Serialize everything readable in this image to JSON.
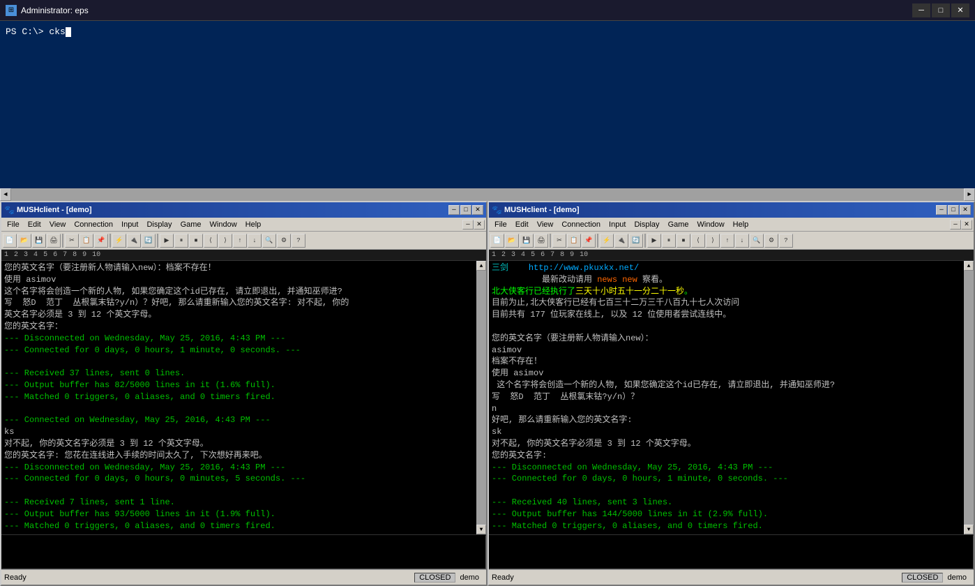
{
  "titlebar": {
    "icon": "⊞",
    "title": "Administrator: eps",
    "minimize": "─",
    "maximize": "□",
    "close": "✕"
  },
  "powershell": {
    "prompt": "PS C:\\> cks"
  },
  "scrollbar": {
    "left_arrow": "◄",
    "right_arrow": "►"
  },
  "panel_left": {
    "title": "MUSHclient - [demo]",
    "menus": [
      "File",
      "Edit",
      "View",
      "Connection",
      "Input",
      "Display",
      "Game",
      "Window",
      "Help"
    ],
    "statusbar": {
      "ready": "Ready",
      "closed": "CLOSED",
      "world": "demo"
    },
    "content": [
      {
        "color": "white",
        "text": "您的英文名字（要注册新人物请输入new）：档案不存在！"
      },
      {
        "color": "white",
        "text": "使用 asimov"
      },
      {
        "color": "white",
        "text": "这个名字将会创造一个新的人物, 如果您确定这个id已存在, 请立即退出, 并通知巫师进?"
      },
      {
        "color": "white",
        "text": "写  怒D  范丁  丛根氯末钴?y/n）？好吧, 那么请重新输入您的英文名字: 对不起, 你的"
      },
      {
        "color": "white",
        "text": "英文名字必须是 3 到 12 个英文字母。"
      },
      {
        "color": "white",
        "text": "您的英文名字："
      },
      {
        "color": "green",
        "text": "--- Disconnected on Wednesday, May 25, 2016, 4:43 PM ---"
      },
      {
        "color": "green",
        "text": "--- Connected for 0 days, 0 hours, 1 minute, 0 seconds. ---"
      },
      {
        "color": "white",
        "text": ""
      },
      {
        "color": "green",
        "text": "--- Received 37 lines, sent 0 lines."
      },
      {
        "color": "green",
        "text": "--- Output buffer has 82/5000 lines in it (1.6% full)."
      },
      {
        "color": "green",
        "text": "--- Matched 0 triggers, 0 aliases, and 0 timers fired."
      },
      {
        "color": "white",
        "text": ""
      },
      {
        "color": "green",
        "text": "--- Connected on Wednesday, May 25, 2016, 4:43 PM ---"
      },
      {
        "color": "white",
        "text": "ks"
      },
      {
        "color": "white",
        "text": "对不起, 你的英文名字必须是 3 到 12 个英文字母。"
      },
      {
        "color": "white",
        "text": "您的英文名字: 您花在连线进入手续的时间太久了, 下次想好再来吧。"
      },
      {
        "color": "green",
        "text": "--- Disconnected on Wednesday, May 25, 2016, 4:43 PM ---"
      },
      {
        "color": "green",
        "text": "--- Connected for 0 days, 0 hours, 0 minutes, 5 seconds. ---"
      },
      {
        "color": "white",
        "text": ""
      },
      {
        "color": "green",
        "text": "--- Received 7 lines, sent 1 line."
      },
      {
        "color": "green",
        "text": "--- Output buffer has 93/5000 lines in it (1.9% full)."
      },
      {
        "color": "green",
        "text": "--- Matched 0 triggers, 0 aliases, and 0 timers fired."
      }
    ]
  },
  "panel_right": {
    "title": "MUSHclient - [demo]",
    "menus": [
      "File",
      "Edit",
      "View",
      "Connection",
      "Input",
      "Display",
      "Game",
      "Window",
      "Help"
    ],
    "statusbar": {
      "ready": "Ready",
      "closed": "CLOSED",
      "world": "demo"
    },
    "content": [
      {
        "color": "cyan",
        "text": "三剑    http://www.pkuxkx.net/"
      },
      {
        "color": "white",
        "text": "          最新改动请用 news new 察看。"
      },
      {
        "color": "bright-white",
        "text": "北大侠客行已经执行了三天十小时五十一分二十一秒。"
      },
      {
        "color": "white",
        "text": "目前为止,北大侠客行已经有七百三十二万三千八百九十七人次访问"
      },
      {
        "color": "white",
        "text": "目前共有 177 位玩家在线上, 以及 12 位使用者尝试连线中。"
      },
      {
        "color": "white",
        "text": ""
      },
      {
        "color": "white",
        "text": "您的英文名字（要注册新人物请输入new）："
      },
      {
        "color": "white",
        "text": "asimov"
      },
      {
        "color": "white",
        "text": "档案不存在！"
      },
      {
        "color": "white",
        "text": "使用 asimov"
      },
      {
        "color": "white",
        "text": " 这个名字将会创造一个新的人物, 如果您确定这个id已存在, 请立即退出, 并通知巫师进?"
      },
      {
        "color": "white",
        "text": "写  怒D  范丁  丛根氯末钴?y/n）？"
      },
      {
        "color": "white",
        "text": "n"
      },
      {
        "color": "white",
        "text": "好吧, 那么请重新输入您的英文名字:"
      },
      {
        "color": "white",
        "text": "sk"
      },
      {
        "color": "white",
        "text": "对不起, 你的英文名字必须是 3 到 12 个英文字母。"
      },
      {
        "color": "white",
        "text": "您的英文名字:"
      },
      {
        "color": "green",
        "text": "--- Disconnected on Wednesday, May 25, 2016, 4:43 PM ---"
      },
      {
        "color": "green",
        "text": "--- Connected for 0 days, 0 hours, 1 minute, 0 seconds. ---"
      },
      {
        "color": "white",
        "text": ""
      },
      {
        "color": "green",
        "text": "--- Received 40 lines, sent 3 lines."
      },
      {
        "color": "green",
        "text": "--- Output buffer has 144/5000 lines in it (2.9% full)."
      },
      {
        "color": "green",
        "text": "--- Matched 0 triggers, 0 aliases, and 0 timers fired."
      }
    ]
  }
}
